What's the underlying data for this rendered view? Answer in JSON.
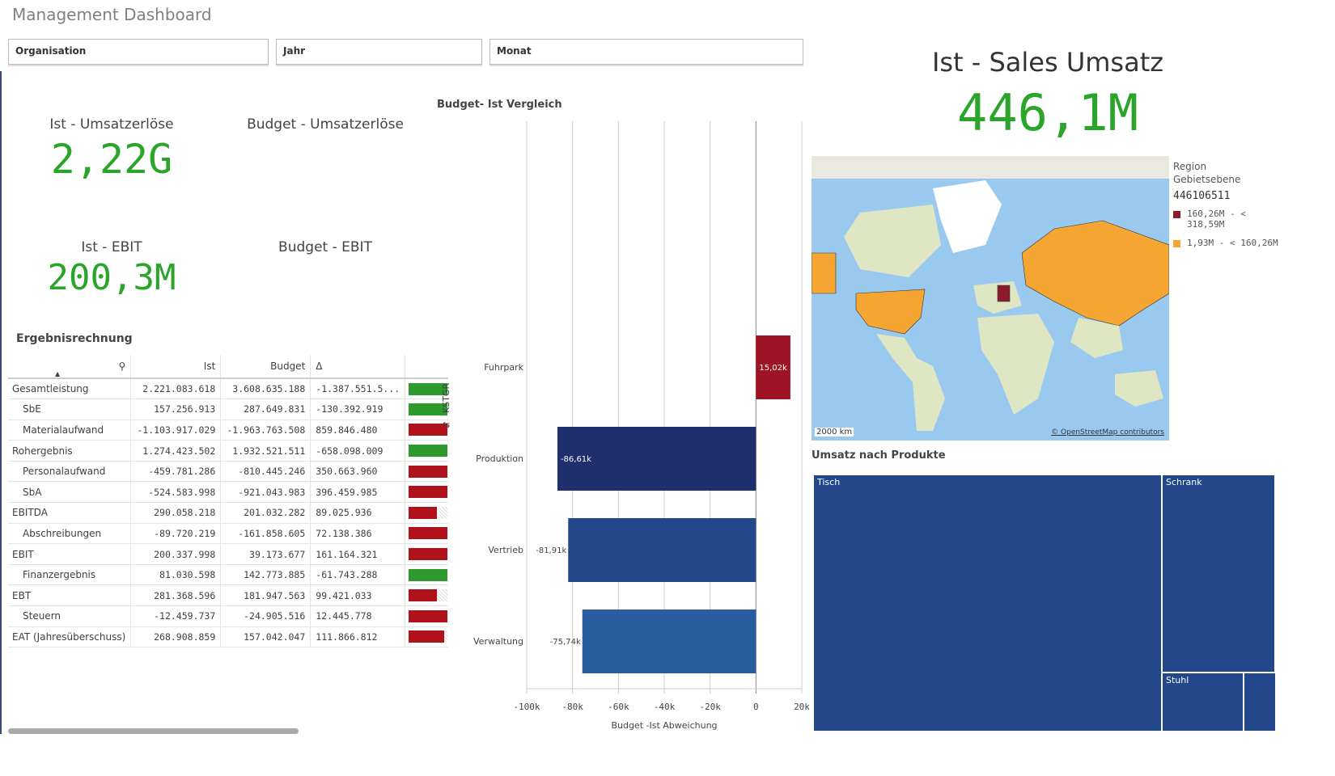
{
  "title": "Management Dashboard",
  "filters": [
    {
      "label": "Organisation"
    },
    {
      "label": "Jahr"
    },
    {
      "label": "Monat"
    }
  ],
  "kpis": {
    "ist_umsatz": {
      "label": "Ist - Umsatzerlöse",
      "value": "2,22G"
    },
    "budget_umsatz": {
      "label": "Budget - Umsatzerlöse",
      "value": ""
    },
    "ist_ebit": {
      "label": "Ist - EBIT",
      "value": "200,3M"
    },
    "budget_ebit": {
      "label": "Budget - EBIT",
      "value": ""
    },
    "sales": {
      "label": "Ist - Sales Umsatz",
      "value": "446,1M"
    }
  },
  "colors": {
    "kpi_green": "#2aa52a",
    "bar_green": "#2e9a2e",
    "bar_red": "#b0121b",
    "navy": "#1f2f6e",
    "blue": "#22478a",
    "lightblue": "#2a5ca0",
    "map_orange": "#f5a531",
    "map_red": "#8b1a2b"
  },
  "table": {
    "title": "Ergebnisrechnung",
    "search_icon": "search-icon",
    "columns": [
      "",
      "Ist",
      "Budget",
      "Δ",
      ""
    ],
    "rows": [
      {
        "name": "Gesamtleistung",
        "indent": false,
        "ist": "2.221.083.618",
        "budget": "3.608.635.188",
        "delta": "-1.387.551.5...",
        "bar_color": "green",
        "fill": 1
      },
      {
        "name": "SbE",
        "indent": true,
        "ist": "157.256.913",
        "budget": "287.649.831",
        "delta": "-130.392.919",
        "bar_color": "green",
        "fill": 1
      },
      {
        "name": "Materialaufwand",
        "indent": true,
        "ist": "-1.103.917.029",
        "budget": "-1.963.763.508",
        "delta": "859.846.480",
        "bar_color": "red",
        "fill": 1
      },
      {
        "name": "Rohergebnis",
        "indent": false,
        "ist": "1.274.423.502",
        "budget": "1.932.521.511",
        "delta": "-658.098.009",
        "bar_color": "green",
        "fill": 1
      },
      {
        "name": "Personalaufwand",
        "indent": true,
        "ist": "-459.781.286",
        "budget": "-810.445.246",
        "delta": "350.663.960",
        "bar_color": "red",
        "fill": 1
      },
      {
        "name": "SbA",
        "indent": true,
        "ist": "-524.583.998",
        "budget": "-921.043.983",
        "delta": "396.459.985",
        "bar_color": "red",
        "fill": 1
      },
      {
        "name": "EBITDA",
        "indent": false,
        "ist": "290.058.218",
        "budget": "201.032.282",
        "delta": "89.025.936",
        "bar_color": "red",
        "fill": 0.72
      },
      {
        "name": "Abschreibungen",
        "indent": true,
        "ist": "-89.720.219",
        "budget": "-161.858.605",
        "delta": "72.138.386",
        "bar_color": "red",
        "fill": 1
      },
      {
        "name": "EBIT",
        "indent": false,
        "ist": "200.337.998",
        "budget": "39.173.677",
        "delta": "161.164.321",
        "bar_color": "red",
        "fill": 1
      },
      {
        "name": "Finanzergebnis",
        "indent": true,
        "ist": "81.030.598",
        "budget": "142.773.885",
        "delta": "-61.743.288",
        "bar_color": "green",
        "fill": 1
      },
      {
        "name": "EBT",
        "indent": false,
        "ist": "281.368.596",
        "budget": "181.947.563",
        "delta": "99.421.033",
        "bar_color": "red",
        "fill": 0.72
      },
      {
        "name": "Steuern",
        "indent": true,
        "ist": "-12.459.737",
        "budget": "-24.905.516",
        "delta": "12.445.778",
        "bar_color": "red",
        "fill": 1
      },
      {
        "name": "EAT (Jahresüberschuss)",
        "indent": false,
        "ist": "268.908.859",
        "budget": "157.042.047",
        "delta": "111.866.812",
        "bar_color": "red",
        "fill": 0.92
      }
    ]
  },
  "chart_data": {
    "type": "bar",
    "orientation": "horizontal",
    "title": "Budget- Ist Vergleich",
    "ylabel": "KSTGR",
    "xlabel": "Budget -Ist Abweichung",
    "categories": [
      "Fuhrpark",
      "Produktion",
      "Vertrieb",
      "Verwaltung"
    ],
    "values": [
      15020,
      -86610,
      -81910,
      -75740
    ],
    "data_labels": [
      "15,02k",
      "-86,61k",
      "-81,91k",
      "-75,74k"
    ],
    "bar_colors": [
      "#9e1426",
      "#1f2f6e",
      "#22478a",
      "#2a5ca0"
    ],
    "xlim": [
      -100000,
      20000
    ],
    "xticks": [
      -100000,
      -80000,
      -60000,
      -40000,
      -20000,
      0,
      20000
    ],
    "xtick_labels": [
      "-100k",
      "-80k",
      "-60k",
      "-40k",
      "-20k",
      "0",
      "20k"
    ],
    "grid": true
  },
  "map": {
    "legend_title": "Region",
    "legend_subtitle": "Gebietsebene",
    "legend_total": "446106511",
    "legend_items": [
      {
        "label": "160,26M - < 318,59M",
        "color": "#8b1a2b"
      },
      {
        "label": "1,93M - < 160,26M",
        "color": "#f5a531"
      }
    ],
    "scale": "2000 km",
    "attribution": "© OpenStreetMap contributors"
  },
  "treemap": {
    "title": "Umsatz nach Produkte",
    "items": [
      {
        "label": "Tisch"
      },
      {
        "label": "Schrank"
      },
      {
        "label": "Stuhl"
      },
      {
        "label": ""
      }
    ]
  }
}
